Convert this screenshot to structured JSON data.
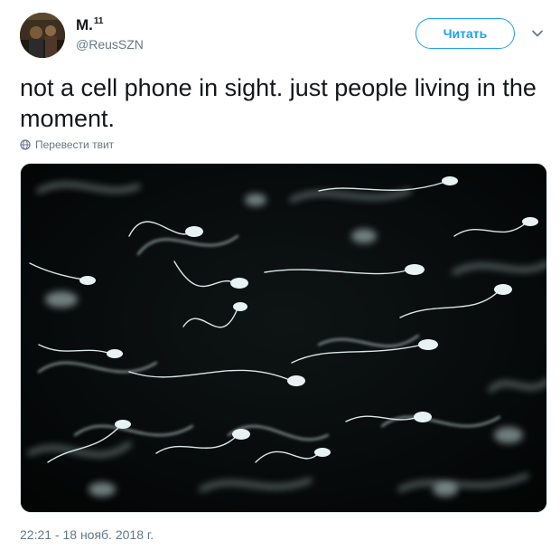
{
  "user": {
    "display_name": "M.",
    "display_name_suffix": "11",
    "handle": "@ReusSZN"
  },
  "follow_button_label": "Читать",
  "tweet_text": "not a cell phone in sight. just people living in the moment.",
  "translate_label": "Перевести твит",
  "timestamp": "22:21 - 18 нояб. 2018 г.",
  "icons": [
    "avatar",
    "chevron-down-icon",
    "globe-icon"
  ],
  "colors": {
    "accent": "#1da1f2",
    "secondary_text": "#657786",
    "primary_text": "#14171a"
  }
}
